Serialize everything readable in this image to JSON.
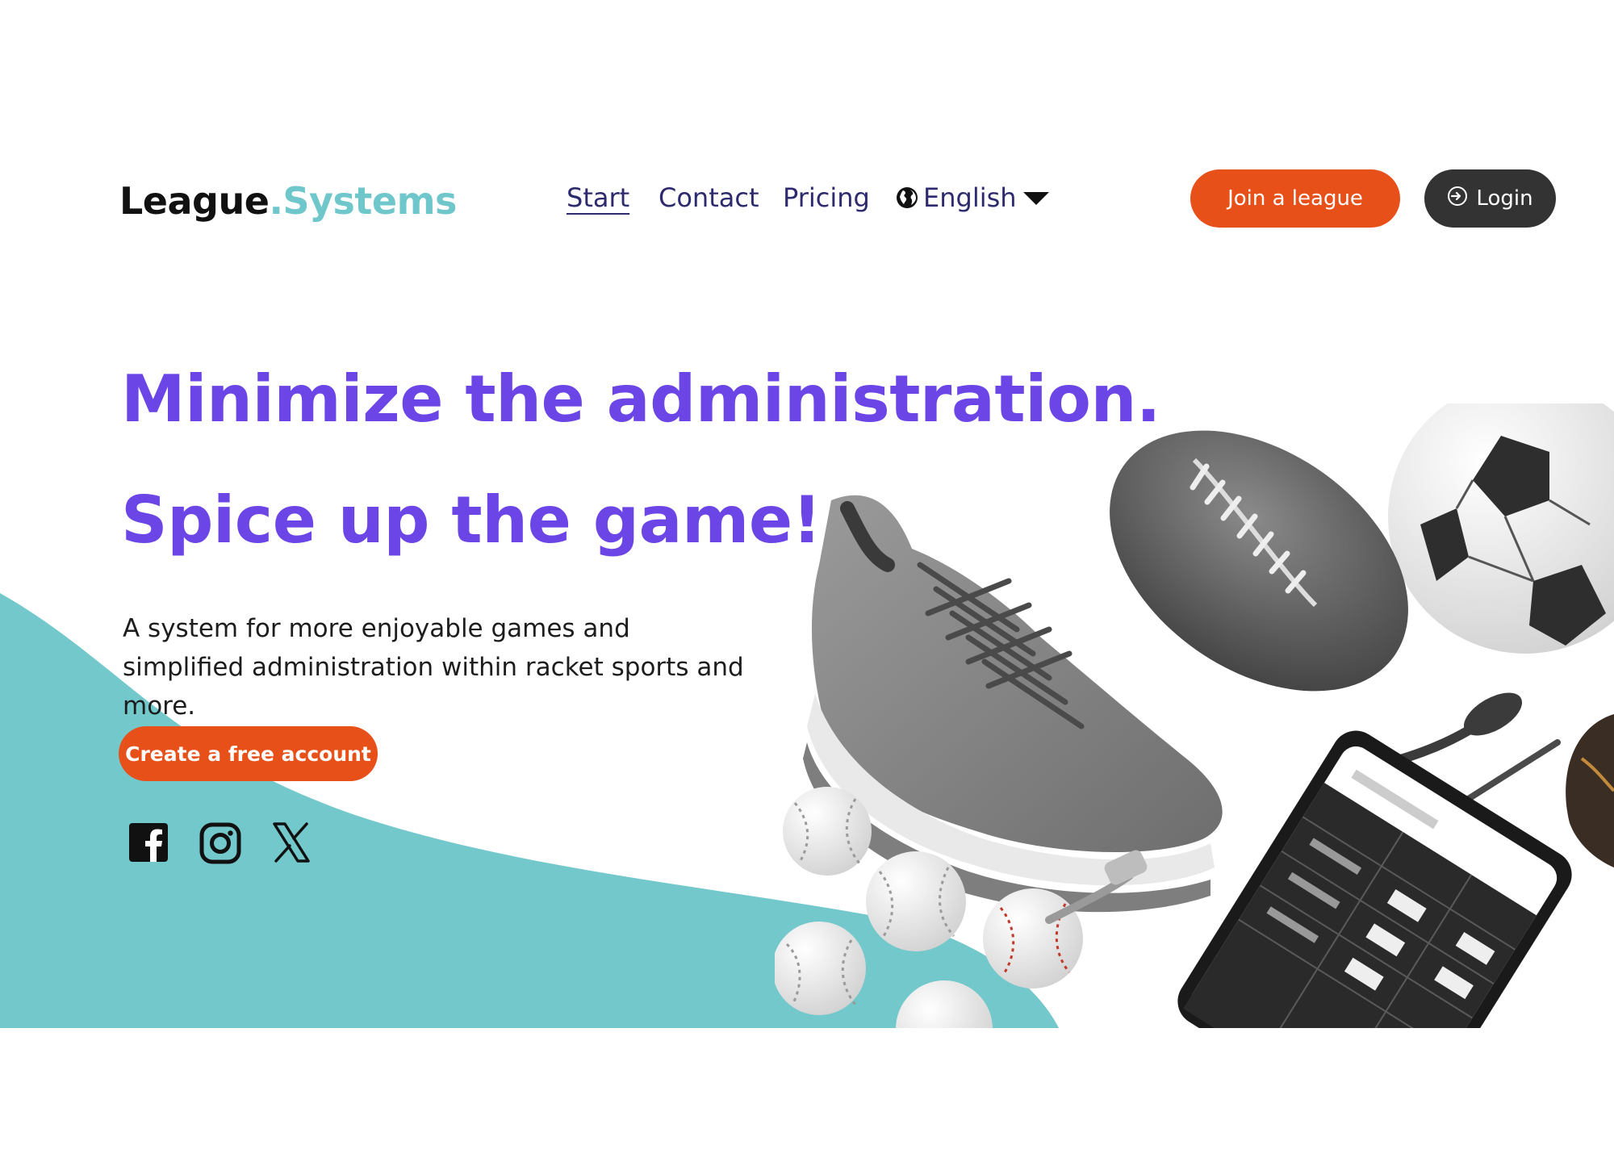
{
  "brand": {
    "part1": "League",
    "dot": ".",
    "part2": "Systems"
  },
  "nav": {
    "items": [
      {
        "label": "Start",
        "active": true
      },
      {
        "label": "Contact",
        "active": false
      },
      {
        "label": "Pricing",
        "active": false
      }
    ],
    "language": {
      "label": "English",
      "icon": "globe-icon"
    }
  },
  "header_buttons": {
    "join": "Join a league",
    "login": "Login",
    "login_icon": "sign-in-icon"
  },
  "hero": {
    "headline_1": "Minimize the administration.",
    "headline_2": "Spice up the game!",
    "description": "A system for more enjoyable games and simplified administration within racket sports and more.",
    "cta": "Create a free account"
  },
  "social": [
    "facebook-icon",
    "instagram-icon",
    "x-icon"
  ],
  "colors": {
    "accent_orange": "#e8501a",
    "headline_purple": "#6c45e6",
    "brand_teal": "#6fc7cb",
    "nav_navy": "#2d2a6e",
    "login_dark": "#333333"
  }
}
